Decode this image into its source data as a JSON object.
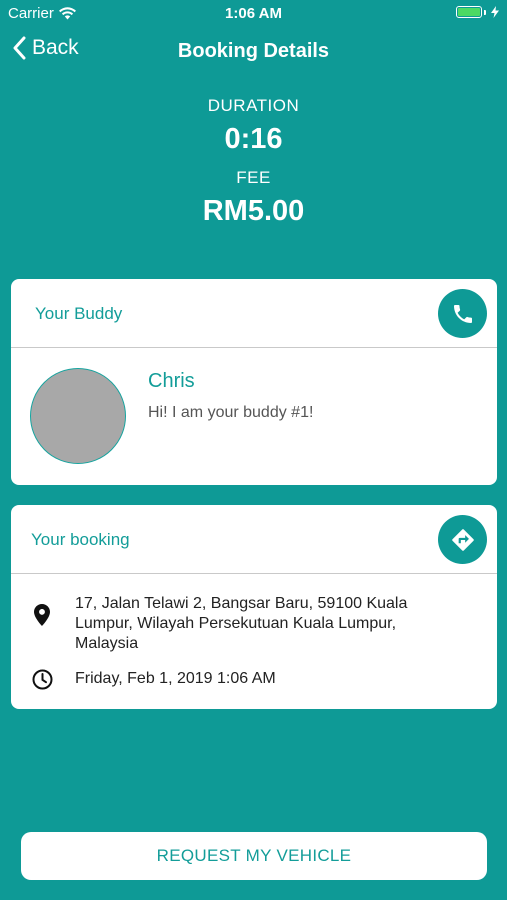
{
  "status_bar": {
    "carrier": "Carrier",
    "time": "1:06 AM",
    "battery_level": 1.0
  },
  "nav": {
    "back_label": "Back",
    "title": "Booking Details"
  },
  "summary": {
    "duration_label": "DURATION",
    "duration_value": "0:16",
    "fee_label": "FEE",
    "fee_value": "RM5.00"
  },
  "buddy_card": {
    "title": "Your Buddy",
    "action_icon": "phone-icon",
    "name": "Chris",
    "message": "Hi! I am your buddy #1!"
  },
  "booking_card": {
    "title": "Your booking",
    "action_icon": "directions-icon",
    "address_lines": [
      "17, Jalan Telawi 2, Bangsar Baru, 59100 Kuala",
      "Lumpur, Wilayah Persekutuan Kuala Lumpur,",
      "Malaysia"
    ],
    "datetime": "Friday, Feb 1, 2019 1:06 AM"
  },
  "actions": {
    "request_label": "REQUEST MY VEHICLE"
  },
  "colors": {
    "accent": "#0e9a96",
    "accent_text": "#139d99",
    "battery": "#4cd964"
  }
}
